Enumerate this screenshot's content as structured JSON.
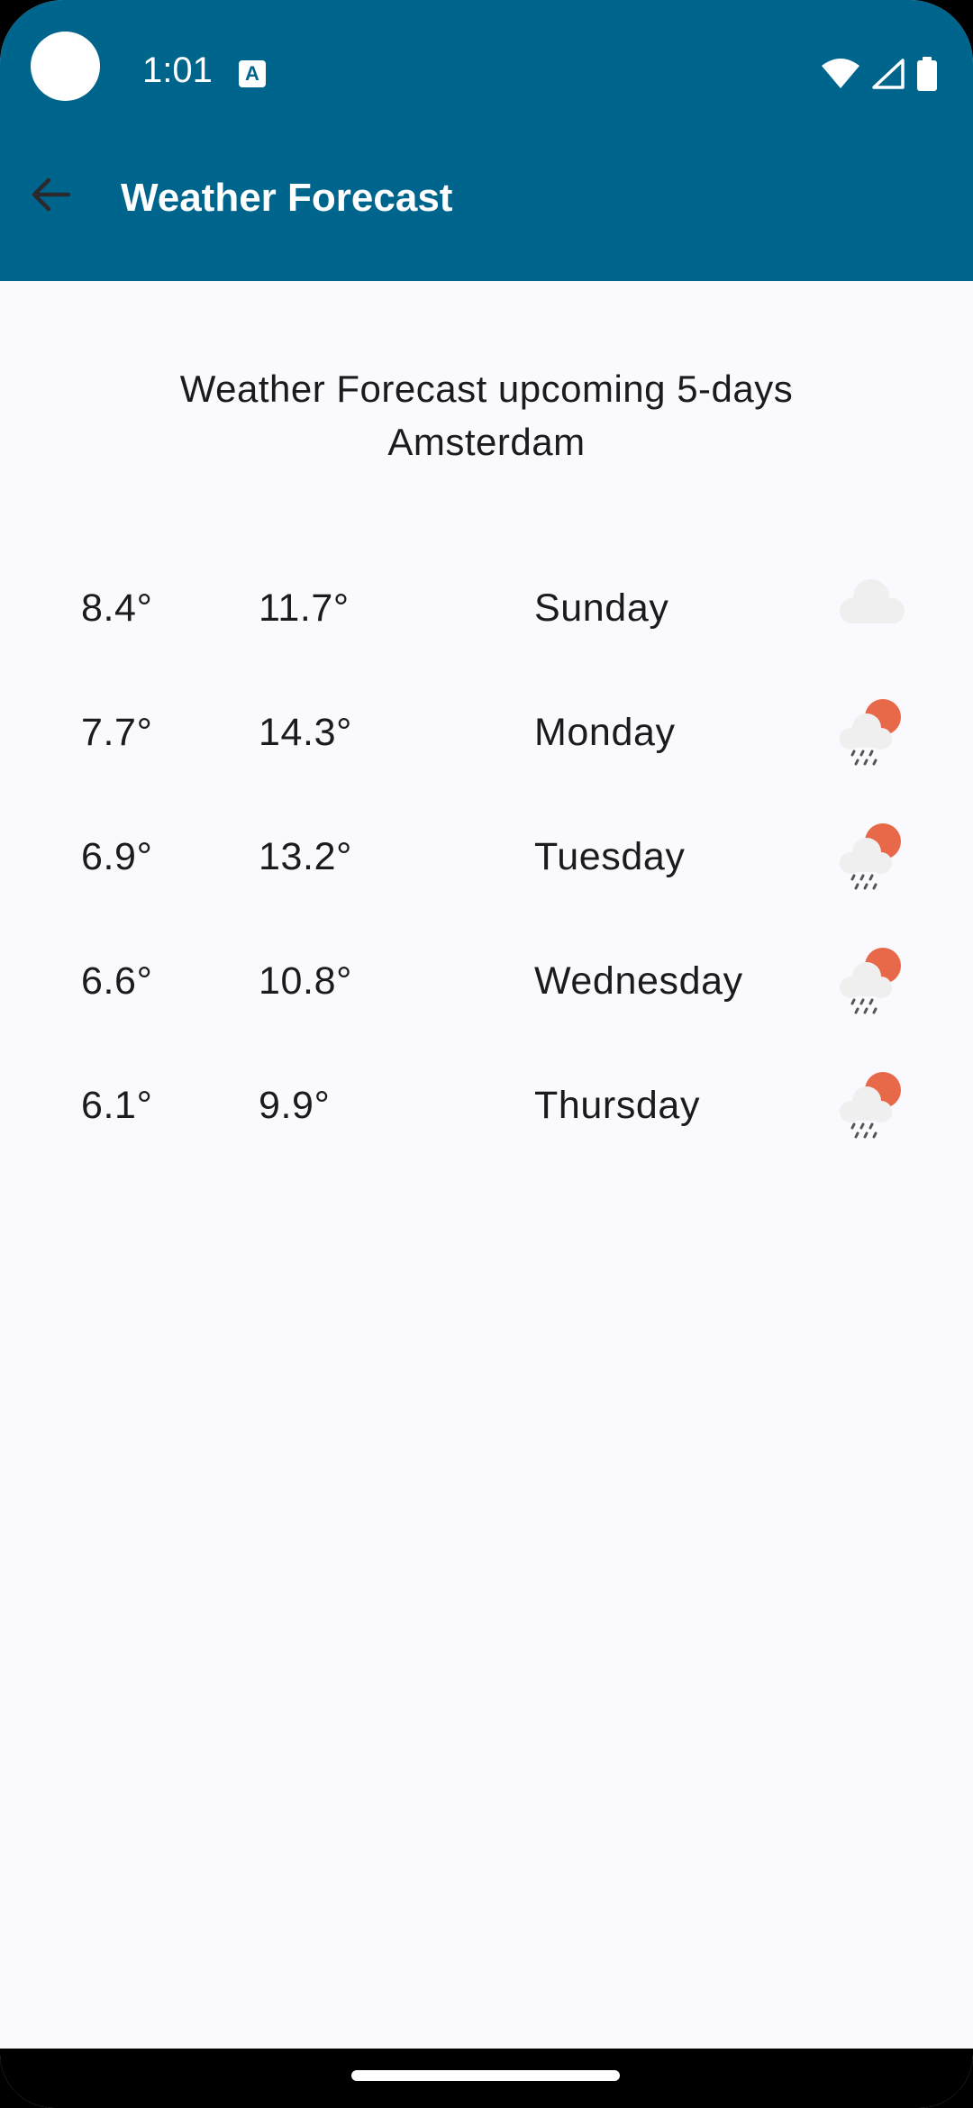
{
  "status_bar": {
    "time": "1:01",
    "notification_icon": "A"
  },
  "app_bar": {
    "title": "Weather Forecast"
  },
  "heading": {
    "line1": "Weather Forecast upcoming 5-days",
    "line2": "Amsterdam"
  },
  "forecast": [
    {
      "min": "8.4°",
      "max": "11.7°",
      "day": "Sunday",
      "icon": "cloud-icon"
    },
    {
      "min": "7.7°",
      "max": "14.3°",
      "day": "Monday",
      "icon": "sun-rain-cloud-icon"
    },
    {
      "min": "6.9°",
      "max": "13.2°",
      "day": "Tuesday",
      "icon": "sun-rain-cloud-icon"
    },
    {
      "min": "6.6°",
      "max": "10.8°",
      "day": "Wednesday",
      "icon": "sun-rain-cloud-icon"
    },
    {
      "min": "6.1°",
      "max": "9.9°",
      "day": "Thursday",
      "icon": "sun-rain-cloud-icon"
    }
  ],
  "colors": {
    "primary": "#00658C",
    "background": "#FAF9FD",
    "text": "#1B1B1F",
    "sun": "#E8684A",
    "cloud": "#EFEFEF"
  }
}
